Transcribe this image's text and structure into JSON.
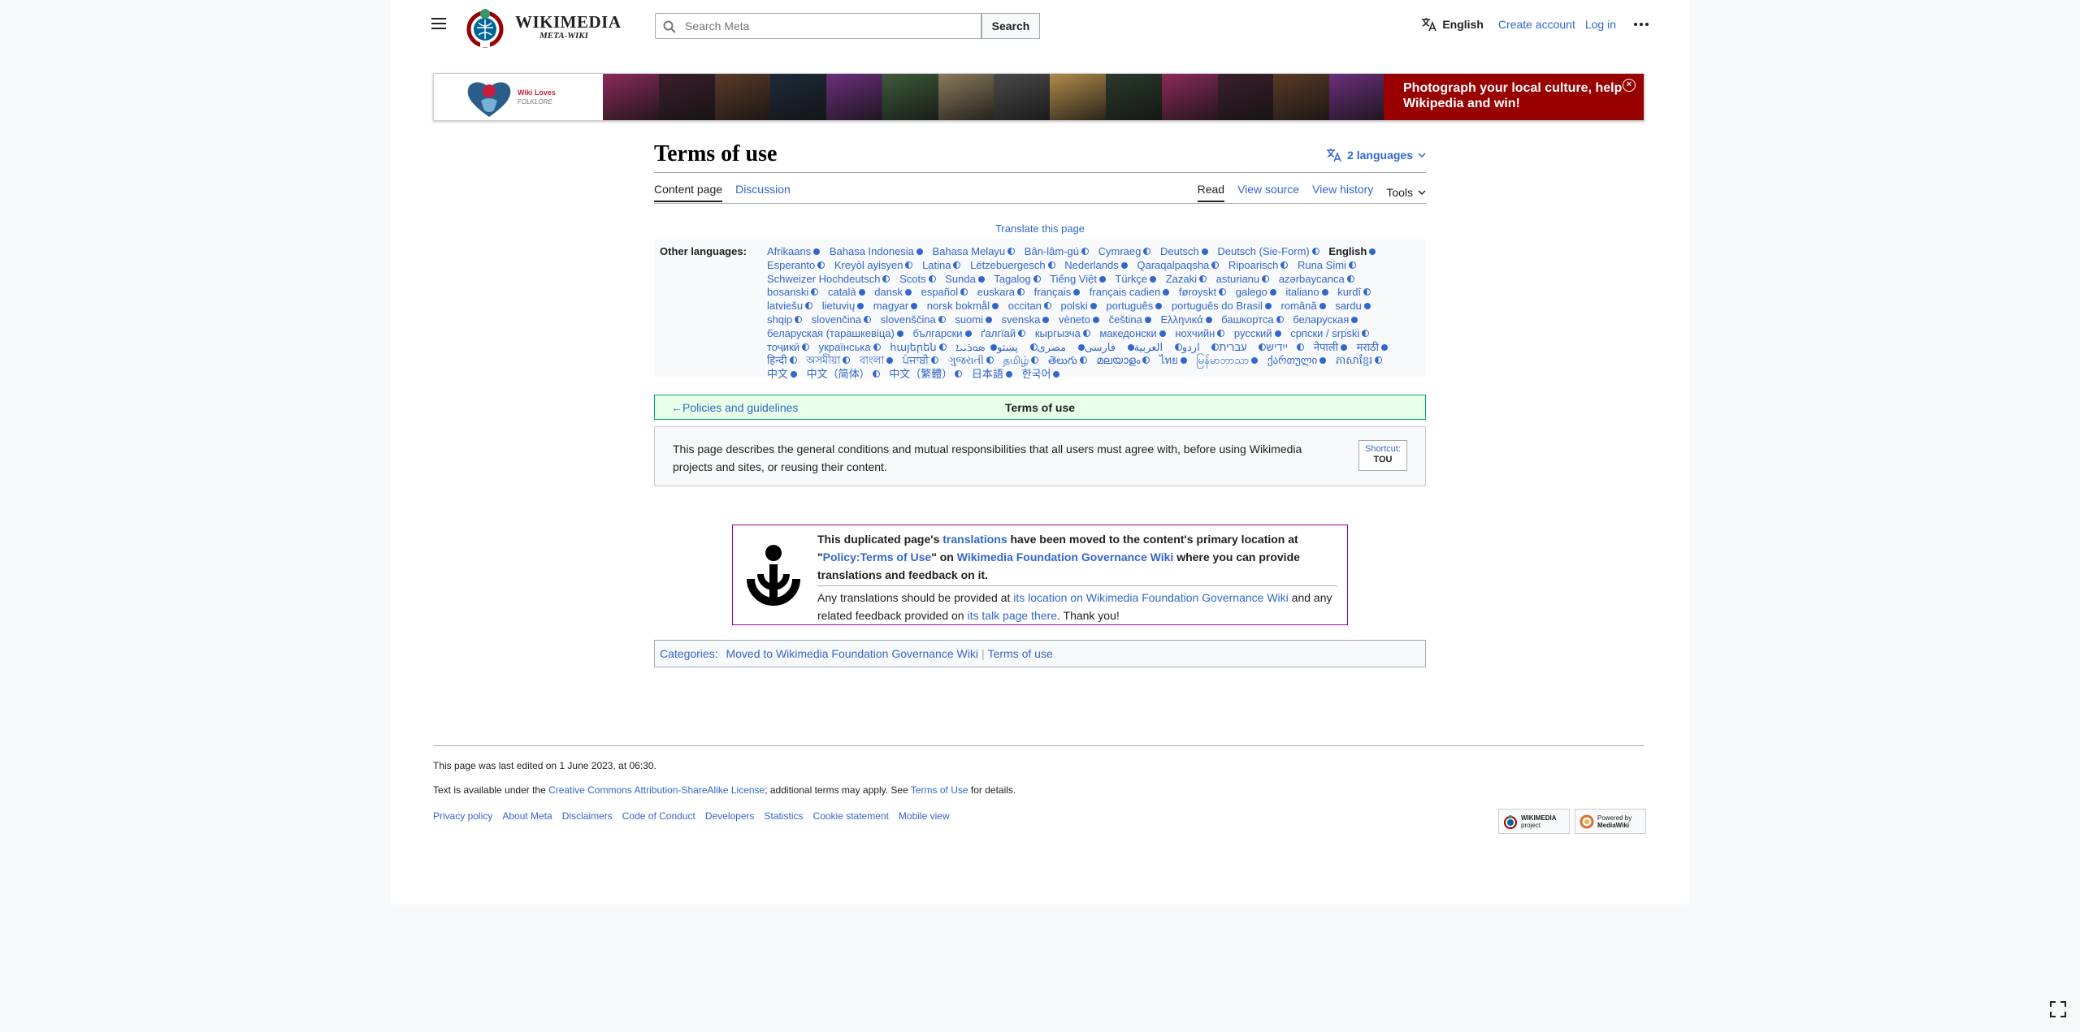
{
  "header": {
    "wordmark_top": "WIKIMEDIA",
    "wordmark_bottom": "META-WIKI",
    "search_placeholder": "Search Meta",
    "search_button": "Search",
    "language": "English",
    "create_account": "Create account",
    "login": "Log in"
  },
  "banner": {
    "logo_line1": "Wiki Loves",
    "logo_line2": "FOLKLORE",
    "cta": "Photograph your local culture, help Wikipedia and win!",
    "close": "×",
    "strip_colors": [
      "#8a2b5a",
      "#3b1f2b",
      "#5a3a28",
      "#1f2a3a",
      "#6b2f7a",
      "#3e5a3a",
      "#8a7a5a",
      "#4a4a4a",
      "#b08a4a",
      "#2a3a2a",
      "#8a2b5a",
      "#3b1f2b",
      "#5a3a28",
      "#6b2f7a"
    ]
  },
  "page": {
    "title": "Terms of use",
    "languages_button": "2 languages",
    "tabs_left": [
      "Content page",
      "Discussion"
    ],
    "tabs_right": {
      "read": "Read",
      "view_source": "View source",
      "view_history": "View history",
      "tools": "Tools"
    },
    "translate_link": "Translate this page",
    "other_languages_label": "Other languages:",
    "other_languages": [
      {
        "n": "Afrikaans",
        "s": "full"
      },
      {
        "n": "Bahasa Indonesia",
        "s": "full"
      },
      {
        "n": "Bahasa Melayu",
        "s": "half"
      },
      {
        "n": "Bân-lâm-gú",
        "s": "half"
      },
      {
        "n": "Cymraeg",
        "s": "half"
      },
      {
        "n": "Deutsch",
        "s": "full"
      },
      {
        "n": "Deutsch (Sie-Form)",
        "s": "half"
      },
      {
        "n": "English",
        "s": "cur"
      },
      {
        "n": "Esperanto",
        "s": "half"
      },
      {
        "n": "Kreyòl ayisyen",
        "s": "half"
      },
      {
        "n": "Latina",
        "s": "half"
      },
      {
        "n": "Lëtzebuergesch",
        "s": "half"
      },
      {
        "n": "Nederlands",
        "s": "full"
      },
      {
        "n": "Qaraqalpaqsha",
        "s": "half"
      },
      {
        "n": "Ripoarisch",
        "s": "half"
      },
      {
        "n": "Runa Simi",
        "s": "half"
      },
      {
        "n": "Schweizer Hochdeutsch",
        "s": "half"
      },
      {
        "n": "Scots",
        "s": "half"
      },
      {
        "n": "Sunda",
        "s": "full"
      },
      {
        "n": "Tagalog",
        "s": "half"
      },
      {
        "n": "Tiếng Việt",
        "s": "full"
      },
      {
        "n": "Türkçe",
        "s": "full"
      },
      {
        "n": "Zazaki",
        "s": "half"
      },
      {
        "n": "asturianu",
        "s": "half"
      },
      {
        "n": "azərbaycanca",
        "s": "half"
      },
      {
        "n": "bosanski",
        "s": "half"
      },
      {
        "n": "català",
        "s": "full"
      },
      {
        "n": "dansk",
        "s": "full"
      },
      {
        "n": "español",
        "s": "half"
      },
      {
        "n": "euskara",
        "s": "half"
      },
      {
        "n": "français",
        "s": "full"
      },
      {
        "n": "français cadien",
        "s": "full"
      },
      {
        "n": "føroyskt",
        "s": "half"
      },
      {
        "n": "galego",
        "s": "full"
      },
      {
        "n": "italiano",
        "s": "full"
      },
      {
        "n": "kurdî",
        "s": "half"
      },
      {
        "n": "latviešu",
        "s": "half"
      },
      {
        "n": "lietuvių",
        "s": "full"
      },
      {
        "n": "magyar",
        "s": "full"
      },
      {
        "n": "norsk bokmål",
        "s": "full"
      },
      {
        "n": "occitan",
        "s": "half"
      },
      {
        "n": "polski",
        "s": "full"
      },
      {
        "n": "português",
        "s": "full"
      },
      {
        "n": "português do Brasil",
        "s": "full"
      },
      {
        "n": "română",
        "s": "full"
      },
      {
        "n": "sardu",
        "s": "full"
      },
      {
        "n": "shqip",
        "s": "half"
      },
      {
        "n": "slovenčina",
        "s": "half"
      },
      {
        "n": "slovenščina",
        "s": "half"
      },
      {
        "n": "suomi",
        "s": "full"
      },
      {
        "n": "svenska",
        "s": "full"
      },
      {
        "n": "vèneto",
        "s": "full"
      },
      {
        "n": "čeština",
        "s": "full"
      },
      {
        "n": "Ελληνικά",
        "s": "full"
      },
      {
        "n": "башкортса",
        "s": "half"
      },
      {
        "n": "беларуская",
        "s": "full"
      },
      {
        "n": "беларуская (тарашкевіца)",
        "s": "full"
      },
      {
        "n": "български",
        "s": "full"
      },
      {
        "n": "ґалгїай",
        "s": "half"
      },
      {
        "n": "кыргызча",
        "s": "half"
      },
      {
        "n": "македонски",
        "s": "full"
      },
      {
        "n": "нохчийн",
        "s": "half"
      },
      {
        "n": "русский",
        "s": "full"
      },
      {
        "n": "српски / srpski",
        "s": "half"
      },
      {
        "n": "тоҷикӣ",
        "s": "half"
      },
      {
        "n": "українська",
        "s": "half"
      },
      {
        "n": "հայերեն",
        "s": "half"
      },
      {
        "n": "ייִדיש",
        "s": "half"
      },
      {
        "n": "עברית",
        "s": "half"
      },
      {
        "n": "اردو",
        "s": "half"
      },
      {
        "n": "العربية",
        "s": "full"
      },
      {
        "n": "فارسی",
        "s": "full"
      },
      {
        "n": "مصرى",
        "s": "half"
      },
      {
        "n": "پښتو",
        "s": "full"
      },
      {
        "n": "ܣܘܪܝܝܐ",
        "s": "half"
      },
      {
        "n": "नेपाली",
        "s": "full"
      },
      {
        "n": "मराठी",
        "s": "full"
      },
      {
        "n": "हिन्दी",
        "s": "half"
      },
      {
        "n": "অসমীয়া",
        "s": "half"
      },
      {
        "n": "বাংলা",
        "s": "full"
      },
      {
        "n": "ਪੰਜਾਬੀ",
        "s": "half"
      },
      {
        "n": "ગુજરાતી",
        "s": "half"
      },
      {
        "n": "தமிழ்",
        "s": "half"
      },
      {
        "n": "తెలుగు",
        "s": "half"
      },
      {
        "n": "മലയാളം",
        "s": "half"
      },
      {
        "n": "ไทย",
        "s": "full"
      },
      {
        "n": "မြန်မာဘာသာ",
        "s": "full"
      },
      {
        "n": "ქართული",
        "s": "full"
      },
      {
        "n": "ភាសាខ្មែរ",
        "s": "half"
      },
      {
        "n": "中文",
        "s": "full"
      },
      {
        "n": "中文（简体）",
        "s": "half"
      },
      {
        "n": "中文（繁體）",
        "s": "half"
      },
      {
        "n": "日本語",
        "s": "full"
      },
      {
        "n": "한국어",
        "s": "full"
      }
    ],
    "nav_back": "←Policies and guidelines",
    "nav_current": "Terms of use",
    "description": "This page describes the general conditions and mutual responsibilities that all users must agree with, before using Wikimedia projects and sites, or reusing their content.",
    "shortcut_label": "Shortcut:",
    "shortcut_value": "TOU",
    "notice": {
      "p1_a": "This duplicated page's ",
      "p1_link1": "translations",
      "p1_b": " have been moved to the content's primary location at \"",
      "p1_link2": "Policy:Terms of Use",
      "p1_c": "\" on ",
      "p1_link3": "Wikimedia Foundation Governance Wiki",
      "p1_d": " where you can provide translations and feedback on it.",
      "p2_a": "Any translations should be provided at ",
      "p2_link1": "its location on Wikimedia Foundation Governance Wiki",
      "p2_b": " and any related feedback provided on ",
      "p2_link2": "its talk page there",
      "p2_c": ". Thank you!"
    },
    "categories_label": "Categories",
    "categories": [
      "Moved to Wikimedia Foundation Governance Wiki",
      "Terms of use"
    ]
  },
  "footer": {
    "last_edited": "This page was last edited on 1 June 2023, at 06:30.",
    "license_a": "Text is available under the ",
    "license_link": "Creative Commons Attribution-ShareAlike License",
    "license_b": "; additional terms may apply. See ",
    "license_link2": "Terms of Use",
    "license_c": " for details.",
    "links": [
      "Privacy policy",
      "About Meta",
      "Disclaimers",
      "Code of Conduct",
      "Developers",
      "Statistics",
      "Cookie statement",
      "Mobile view"
    ],
    "badge1_a": "WIKIMEDIA",
    "badge1_b": "project",
    "badge2_a": "Powered by",
    "badge2_b": "MediaWiki"
  }
}
